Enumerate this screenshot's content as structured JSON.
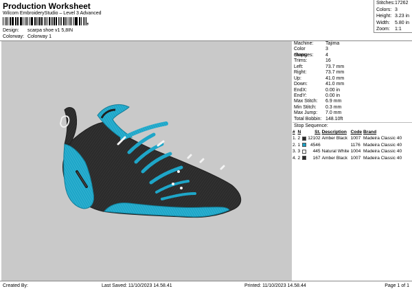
{
  "header": {
    "title": "Production Worksheet",
    "subtitle": "Wilcom EmbroideryStudio – Level 3 Advanced",
    "barcode_suffix": ",",
    "design_label": "Design:",
    "design_value": "scarpa shoe v1 5,8IN",
    "colorway_label": "Colorway:",
    "colorway_value": "Colorway 1"
  },
  "stats": [
    {
      "label": "Stitches:",
      "value": "17262"
    },
    {
      "label": "Colors:",
      "value": "3"
    },
    {
      "label": "Height:",
      "value": "3.23 in"
    },
    {
      "label": "Width:",
      "value": "5.80 in"
    },
    {
      "label": "Zoom:",
      "value": "1:1"
    }
  ],
  "machine_info": [
    {
      "label": "Machine:",
      "value": "Tajima"
    },
    {
      "label": "Color changes:",
      "value": "3"
    },
    {
      "label": "Stops:",
      "value": "4"
    },
    {
      "label": "Trims:",
      "value": "16"
    },
    {
      "label": "Left:",
      "value": "73.7 mm"
    },
    {
      "label": "Right:",
      "value": "73.7 mm"
    },
    {
      "label": "Up:",
      "value": "41.0 mm"
    },
    {
      "label": "Down:",
      "value": "41.0 mm"
    },
    {
      "label": "EndX:",
      "value": "0.00 in"
    },
    {
      "label": "EndY:",
      "value": "0.00 in"
    },
    {
      "label": "Max Stitch:",
      "value": "6.9 mm"
    },
    {
      "label": "Min Stitch:",
      "value": "0.3 mm"
    },
    {
      "label": "Max Jump:",
      "value": "7.0 mm"
    },
    {
      "label": "Total Bobbin:",
      "value": "148.10ft"
    }
  ],
  "sequence": {
    "title": "Stop Sequence:",
    "headers": {
      "hash": "#",
      "n": "N",
      "st": "St.",
      "desc": "Description",
      "code": "Code",
      "brand": "Brand"
    },
    "rows": [
      {
        "index": "1.",
        "n": "2",
        "color": "#2a2a2a",
        "st": "12102",
        "desc": "Amber Black",
        "code": "1007",
        "brand": "Madeira Classic 40"
      },
      {
        "index": "2.",
        "n": "1",
        "color": "#1b9fc4",
        "st": "4546",
        "desc": "",
        "code": "1176",
        "brand": "Madeira Classic 40"
      },
      {
        "index": "3.",
        "n": "3",
        "color": "#f2f2f2",
        "st": "445",
        "desc": "Natural White",
        "code": "1004",
        "brand": "Madeira Classic 40"
      },
      {
        "index": "4.",
        "n": "2",
        "color": "#2a2a2a",
        "st": "167",
        "desc": "Amber Black",
        "code": "1007",
        "brand": "Madeira Classic 40"
      }
    ]
  },
  "footer": {
    "created_by": "Created By:",
    "last_saved": "Last Saved: 11/10/2023 14.58.41",
    "printed": "Printed: 11/10/2023 14.58.44",
    "page": "Page 1 of 1"
  },
  "colors": {
    "black_thread": "#2b2b2b",
    "blue_thread": "#1ea6c8",
    "white_thread": "#f4f4f4",
    "canvas_bg": "#c9c9c9"
  },
  "icons": {
    "design_preview": "embroidery-shoe-design"
  }
}
